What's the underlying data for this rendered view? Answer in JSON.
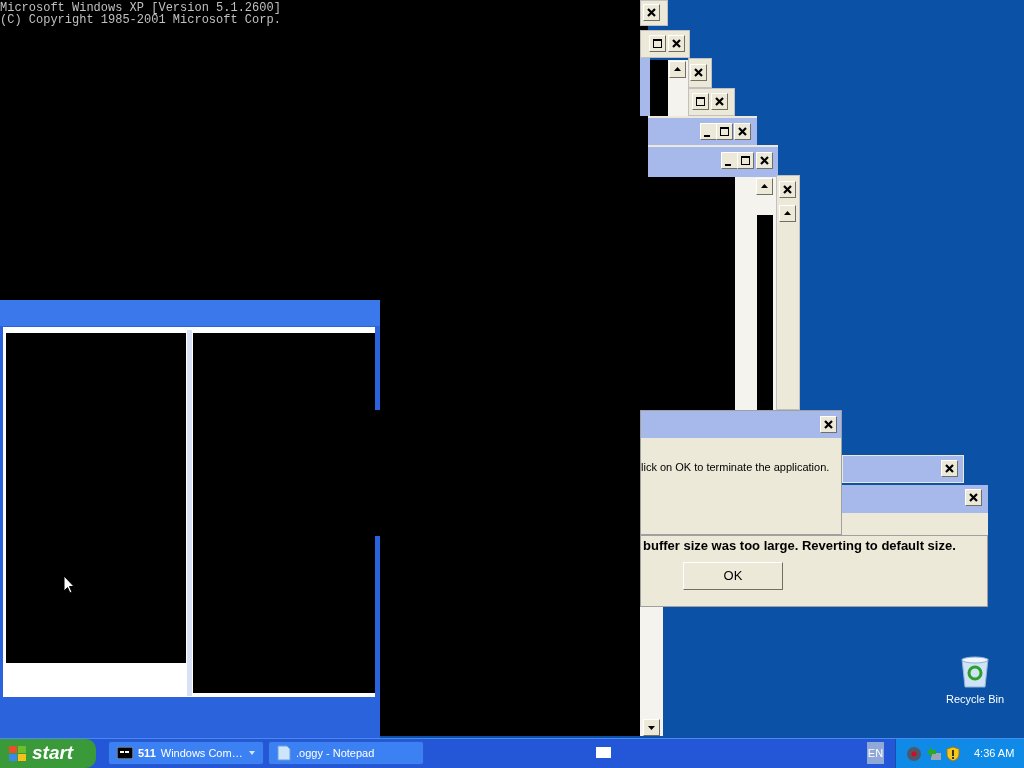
{
  "console": {
    "lines": [
      "Microsoft Windows XP [Version 5.1.2600]",
      "(C) Copyright 1985-2001 Microsoft Corp."
    ]
  },
  "dialogs": [
    {
      "message": "lick on OK to terminate the application."
    },
    {
      "message": "buffer size was too large. Reverting to default size.",
      "button": "OK"
    }
  ],
  "desktop_icons": [
    {
      "label": "Recycle Bin"
    }
  ],
  "taskbar": {
    "start": "start",
    "tasks": [
      {
        "kind": "group",
        "count": "511",
        "label": "Windows Com…"
      },
      {
        "kind": "single",
        "label": ".oggy - Notepad"
      }
    ],
    "language": "EN",
    "clock": "4:36 AM"
  }
}
